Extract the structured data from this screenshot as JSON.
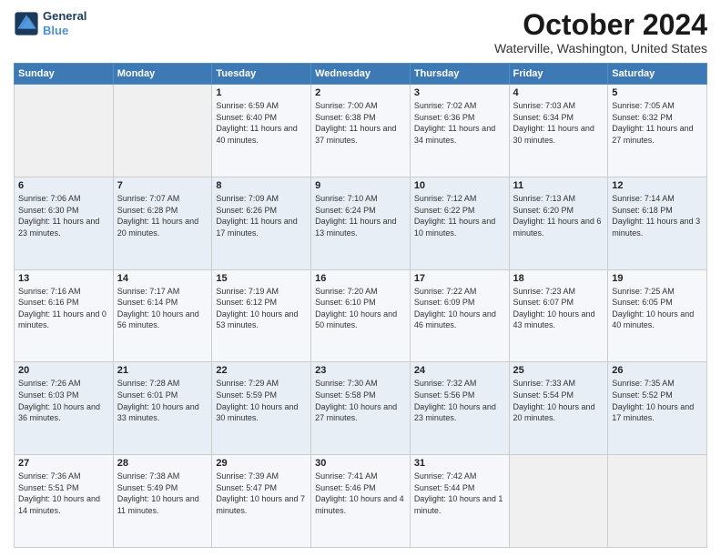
{
  "header": {
    "logo": {
      "line1": "General",
      "line2": "Blue"
    },
    "title": "October 2024",
    "location": "Waterville, Washington, United States"
  },
  "weekdays": [
    "Sunday",
    "Monday",
    "Tuesday",
    "Wednesday",
    "Thursday",
    "Friday",
    "Saturday"
  ],
  "weeks": [
    [
      {
        "day": "",
        "info": ""
      },
      {
        "day": "",
        "info": ""
      },
      {
        "day": "1",
        "info": "Sunrise: 6:59 AM\nSunset: 6:40 PM\nDaylight: 11 hours and 40 minutes."
      },
      {
        "day": "2",
        "info": "Sunrise: 7:00 AM\nSunset: 6:38 PM\nDaylight: 11 hours and 37 minutes."
      },
      {
        "day": "3",
        "info": "Sunrise: 7:02 AM\nSunset: 6:36 PM\nDaylight: 11 hours and 34 minutes."
      },
      {
        "day": "4",
        "info": "Sunrise: 7:03 AM\nSunset: 6:34 PM\nDaylight: 11 hours and 30 minutes."
      },
      {
        "day": "5",
        "info": "Sunrise: 7:05 AM\nSunset: 6:32 PM\nDaylight: 11 hours and 27 minutes."
      }
    ],
    [
      {
        "day": "6",
        "info": "Sunrise: 7:06 AM\nSunset: 6:30 PM\nDaylight: 11 hours and 23 minutes."
      },
      {
        "day": "7",
        "info": "Sunrise: 7:07 AM\nSunset: 6:28 PM\nDaylight: 11 hours and 20 minutes."
      },
      {
        "day": "8",
        "info": "Sunrise: 7:09 AM\nSunset: 6:26 PM\nDaylight: 11 hours and 17 minutes."
      },
      {
        "day": "9",
        "info": "Sunrise: 7:10 AM\nSunset: 6:24 PM\nDaylight: 11 hours and 13 minutes."
      },
      {
        "day": "10",
        "info": "Sunrise: 7:12 AM\nSunset: 6:22 PM\nDaylight: 11 hours and 10 minutes."
      },
      {
        "day": "11",
        "info": "Sunrise: 7:13 AM\nSunset: 6:20 PM\nDaylight: 11 hours and 6 minutes."
      },
      {
        "day": "12",
        "info": "Sunrise: 7:14 AM\nSunset: 6:18 PM\nDaylight: 11 hours and 3 minutes."
      }
    ],
    [
      {
        "day": "13",
        "info": "Sunrise: 7:16 AM\nSunset: 6:16 PM\nDaylight: 11 hours and 0 minutes."
      },
      {
        "day": "14",
        "info": "Sunrise: 7:17 AM\nSunset: 6:14 PM\nDaylight: 10 hours and 56 minutes."
      },
      {
        "day": "15",
        "info": "Sunrise: 7:19 AM\nSunset: 6:12 PM\nDaylight: 10 hours and 53 minutes."
      },
      {
        "day": "16",
        "info": "Sunrise: 7:20 AM\nSunset: 6:10 PM\nDaylight: 10 hours and 50 minutes."
      },
      {
        "day": "17",
        "info": "Sunrise: 7:22 AM\nSunset: 6:09 PM\nDaylight: 10 hours and 46 minutes."
      },
      {
        "day": "18",
        "info": "Sunrise: 7:23 AM\nSunset: 6:07 PM\nDaylight: 10 hours and 43 minutes."
      },
      {
        "day": "19",
        "info": "Sunrise: 7:25 AM\nSunset: 6:05 PM\nDaylight: 10 hours and 40 minutes."
      }
    ],
    [
      {
        "day": "20",
        "info": "Sunrise: 7:26 AM\nSunset: 6:03 PM\nDaylight: 10 hours and 36 minutes."
      },
      {
        "day": "21",
        "info": "Sunrise: 7:28 AM\nSunset: 6:01 PM\nDaylight: 10 hours and 33 minutes."
      },
      {
        "day": "22",
        "info": "Sunrise: 7:29 AM\nSunset: 5:59 PM\nDaylight: 10 hours and 30 minutes."
      },
      {
        "day": "23",
        "info": "Sunrise: 7:30 AM\nSunset: 5:58 PM\nDaylight: 10 hours and 27 minutes."
      },
      {
        "day": "24",
        "info": "Sunrise: 7:32 AM\nSunset: 5:56 PM\nDaylight: 10 hours and 23 minutes."
      },
      {
        "day": "25",
        "info": "Sunrise: 7:33 AM\nSunset: 5:54 PM\nDaylight: 10 hours and 20 minutes."
      },
      {
        "day": "26",
        "info": "Sunrise: 7:35 AM\nSunset: 5:52 PM\nDaylight: 10 hours and 17 minutes."
      }
    ],
    [
      {
        "day": "27",
        "info": "Sunrise: 7:36 AM\nSunset: 5:51 PM\nDaylight: 10 hours and 14 minutes."
      },
      {
        "day": "28",
        "info": "Sunrise: 7:38 AM\nSunset: 5:49 PM\nDaylight: 10 hours and 11 minutes."
      },
      {
        "day": "29",
        "info": "Sunrise: 7:39 AM\nSunset: 5:47 PM\nDaylight: 10 hours and 7 minutes."
      },
      {
        "day": "30",
        "info": "Sunrise: 7:41 AM\nSunset: 5:46 PM\nDaylight: 10 hours and 4 minutes."
      },
      {
        "day": "31",
        "info": "Sunrise: 7:42 AM\nSunset: 5:44 PM\nDaylight: 10 hours and 1 minute."
      },
      {
        "day": "",
        "info": ""
      },
      {
        "day": "",
        "info": ""
      }
    ]
  ]
}
